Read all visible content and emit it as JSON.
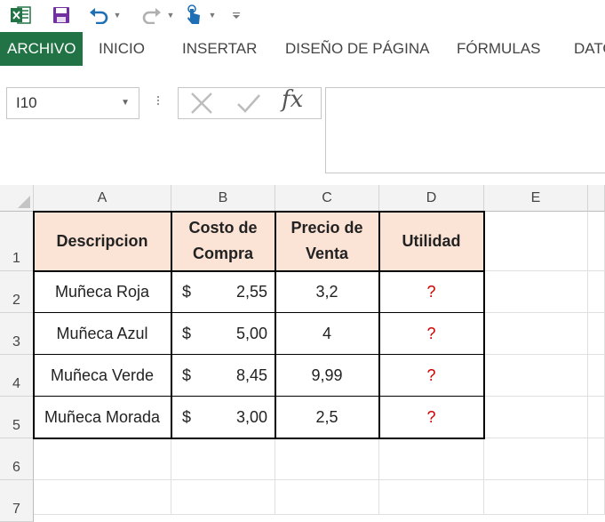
{
  "ribbon": {
    "tabs": [
      "ARCHIVO",
      "INICIO",
      "INSERTAR",
      "DISEÑO DE PÁGINA",
      "FÓRMULAS",
      "DATO"
    ]
  },
  "formula_bar": {
    "name_box": "I10",
    "fx_label": "fx",
    "content": ""
  },
  "sheet": {
    "columns": [
      "A",
      "B",
      "C",
      "D",
      "E"
    ],
    "rows": [
      "1",
      "2",
      "3",
      "4",
      "5",
      "6",
      "7"
    ],
    "header": {
      "a": "Descripcion",
      "b": "Costo de Compra",
      "c": "Precio de Venta",
      "d": "Utilidad"
    },
    "currency_symbol": "$",
    "data": [
      {
        "desc": "Muñeca Roja",
        "costo": "2,55",
        "precio": "3,2",
        "utilidad": "?"
      },
      {
        "desc": "Muñeca Azul",
        "costo": "5,00",
        "precio": "4",
        "utilidad": "?"
      },
      {
        "desc": "Muñeca Verde",
        "costo": "8,45",
        "precio": "9,99",
        "utilidad": "?"
      },
      {
        "desc": "Muñeca Morada",
        "costo": "3,00",
        "precio": "2,5",
        "utilidad": "?"
      }
    ]
  },
  "colors": {
    "accent": "#217346",
    "header_fill": "#fbe4d6",
    "question": "#d10000"
  }
}
